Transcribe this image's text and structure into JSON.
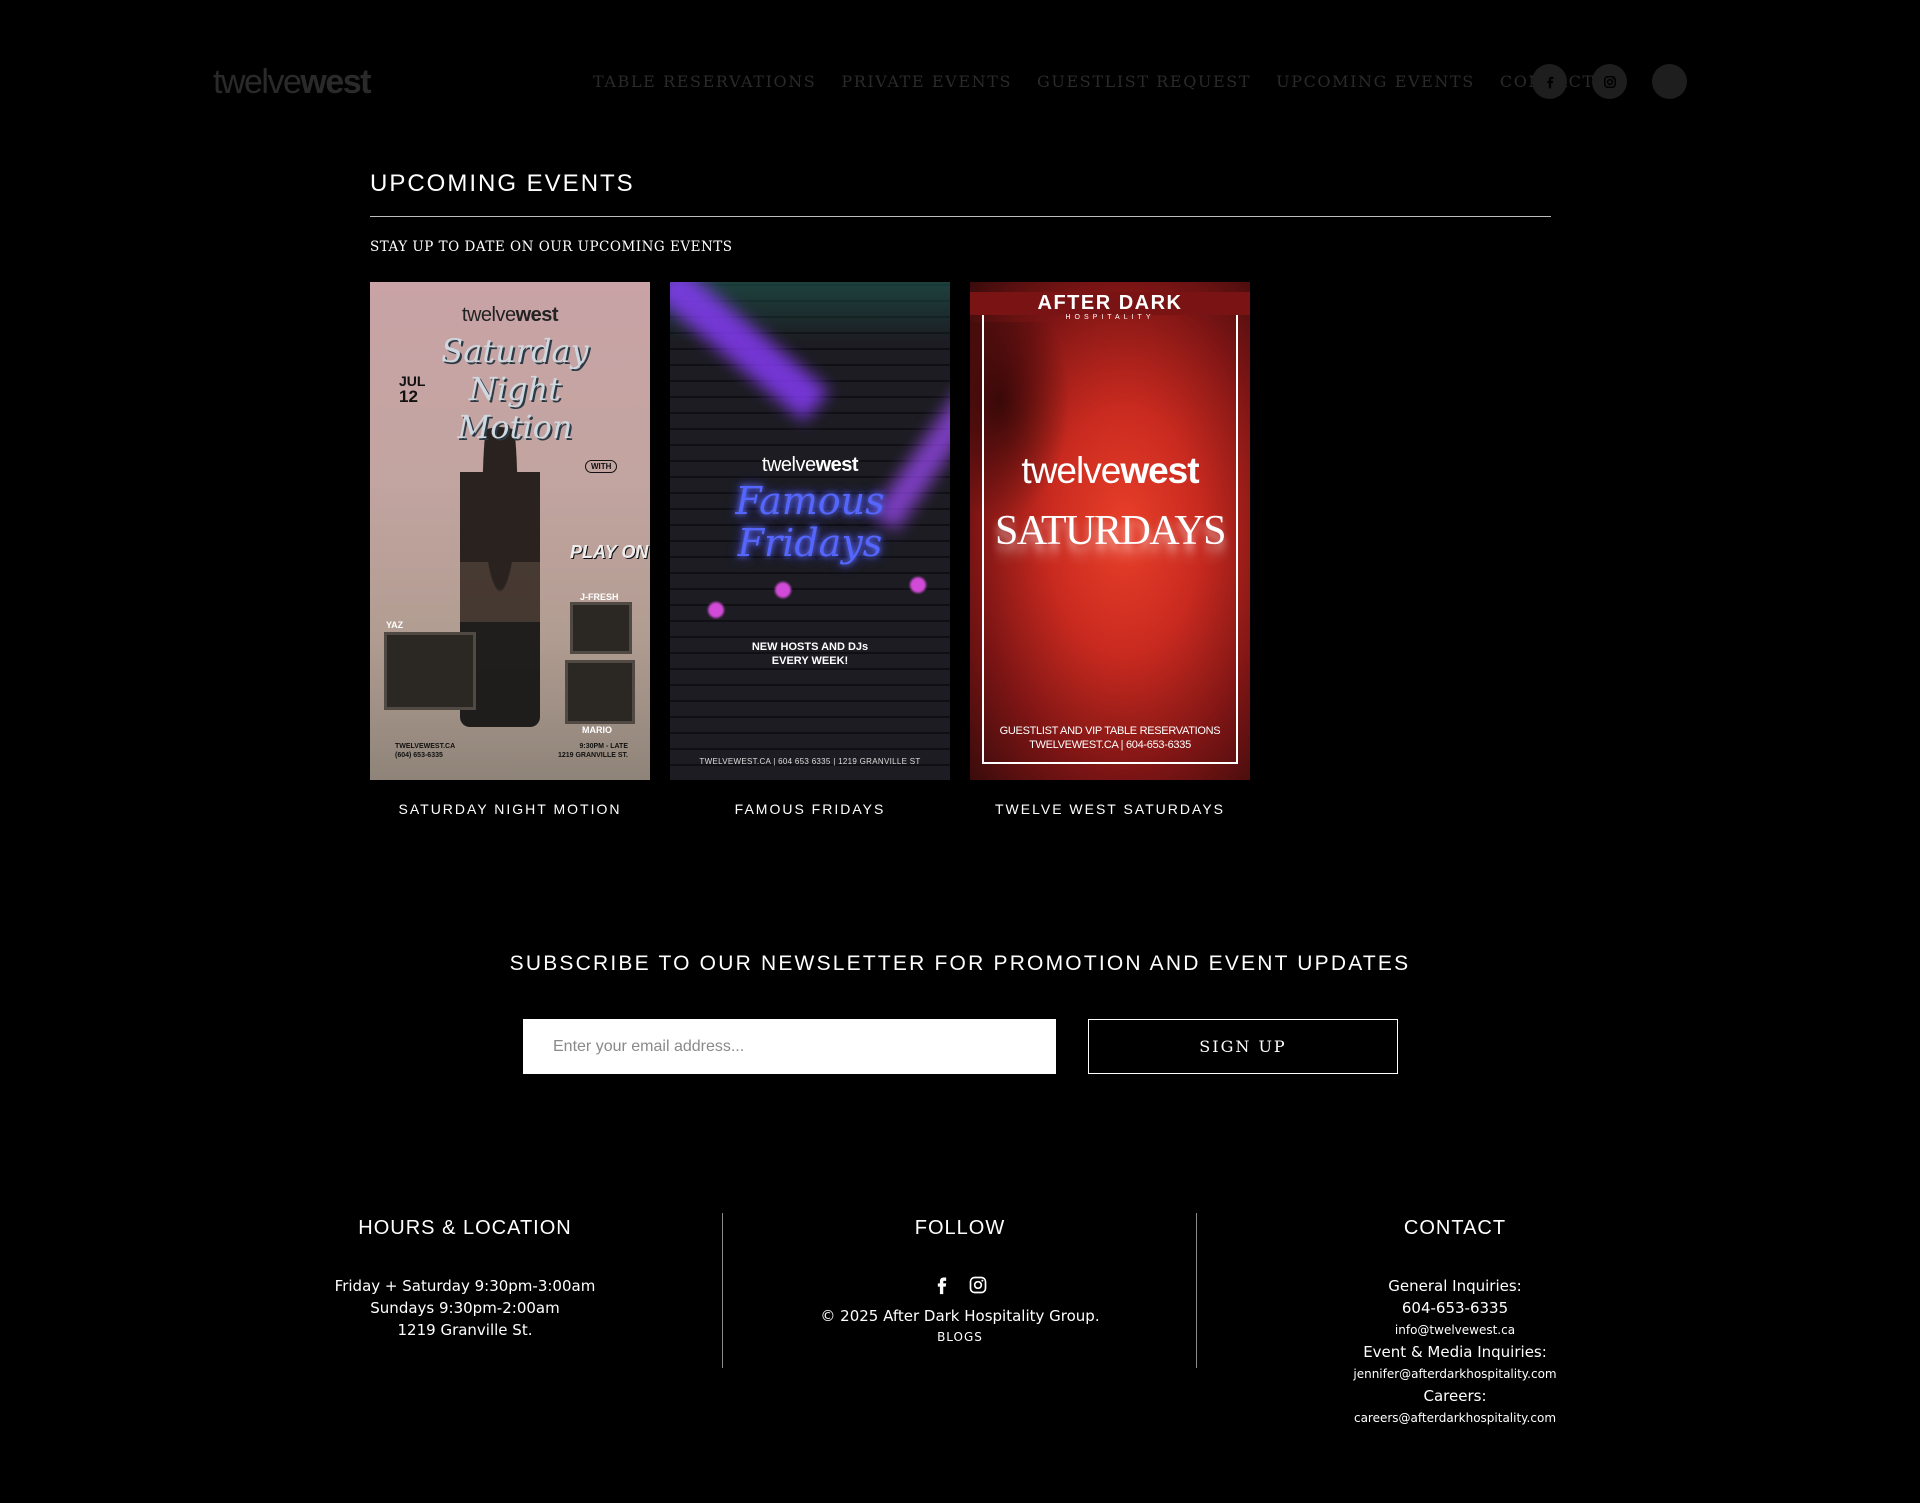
{
  "header": {
    "logo_thin": "twelve",
    "logo_bold": "west",
    "nav": [
      "TABLE RESERVATIONS",
      "PRIVATE EVENTS",
      "GUESTLIST REQUEST",
      "UPCOMING EVENTS",
      "CONTACT"
    ],
    "social_icons": [
      "facebook-icon",
      "instagram-icon",
      "blank-circle-icon"
    ]
  },
  "section": {
    "title": "UPCOMING EVENTS",
    "subtitle": "STAY UP TO DATE ON OUR UPCOMING EVENTS"
  },
  "events": [
    {
      "title": "SATURDAY NIGHT MOTION",
      "poster": {
        "brand_thin": "twelve",
        "brand_bold": "west",
        "script": "Saturday Night Motion",
        "date_month": "JUL",
        "date_day": "12",
        "with": "WITH",
        "play": "PLAY ON",
        "dj1": "YAZ",
        "dj2": "J-FRESH",
        "dj3": "MARIO",
        "foot_left_1": "TWELVEWEST.CA",
        "foot_left_2": "(604) 653-6335",
        "foot_right_1": "9:30PM - LATE",
        "foot_right_2": "1219 GRANVILLE ST."
      }
    },
    {
      "title": "FAMOUS FRIDAYS",
      "poster": {
        "brand_thin": "twelve",
        "brand_bold": "west",
        "script_1": "Famous",
        "script_2": "Fridays",
        "sub_1": "NEW HOSTS AND DJs",
        "sub_2": "EVERY WEEK!",
        "foot": "TWELVEWEST.CA | 604 653 6335 | 1219 GRANVILLE ST"
      }
    },
    {
      "title": "TWELVE WEST SATURDAYS",
      "poster": {
        "after_dark": "AFTER DARK",
        "hospitality": "HOSPITALITY",
        "brand_thin": "twelve",
        "brand_bold": "west",
        "big": "SATURDAYS",
        "foot_1": "GUESTLIST AND VIP TABLE RESERVATIONS",
        "foot_2": "TWELVEWEST.CA | 604-653-6335"
      }
    }
  ],
  "newsletter": {
    "title": "SUBSCRIBE TO OUR NEWSLETTER FOR PROMOTION AND EVENT UPDATES",
    "email_placeholder": "Enter your email address...",
    "button": "SIGN UP"
  },
  "footer": {
    "hours": {
      "title": "HOURS & LOCATION",
      "line1": "Friday + Saturday 9:30pm-3:00am",
      "line2": "Sundays 9:30pm-2:00am",
      "line3": "1219 Granville St."
    },
    "follow": {
      "title": "FOLLOW",
      "copyright": "© 2025 After Dark Hospitality Group.",
      "blogs": "BLOGS"
    },
    "contact": {
      "title": "CONTACT",
      "general_label": "General Inquiries:",
      "general_phone": "604-653-6335",
      "general_email": "info@twelvewest.ca",
      "media_label": "Event & Media Inquiries:",
      "media_email": "jennifer@afterdarkhospitality.com",
      "careers_label": "Careers:",
      "careers_email": "careers@afterdarkhospitality.com"
    }
  }
}
